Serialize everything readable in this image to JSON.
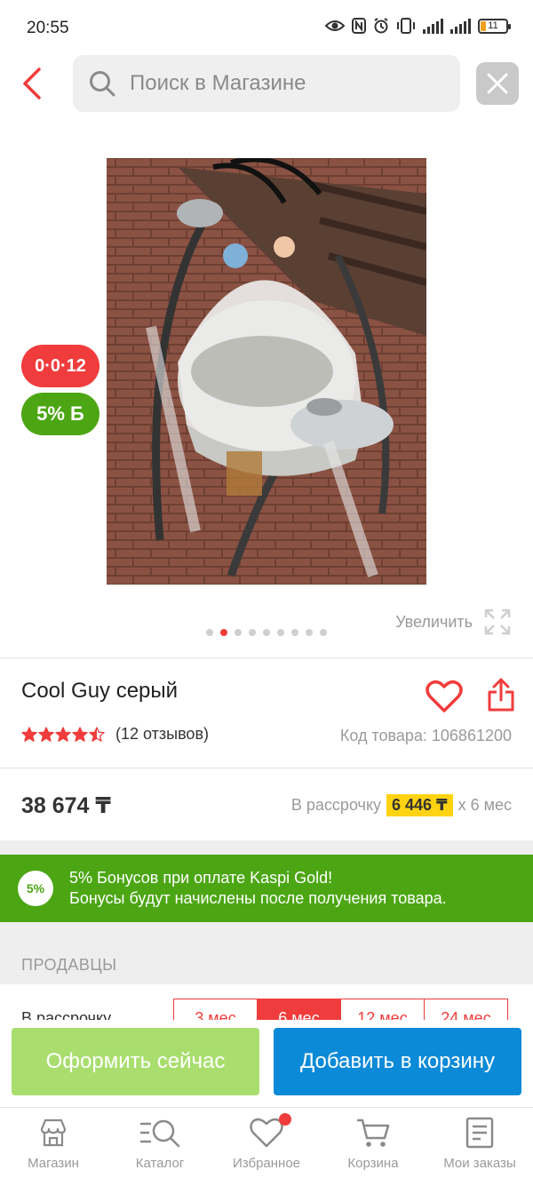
{
  "status_bar": {
    "time": "20:55",
    "battery_level": "11"
  },
  "search": {
    "placeholder": "Поиск в Магазине"
  },
  "product": {
    "image_alt": "photo",
    "badge_installment": "0·0·12",
    "badge_bonus": "5% Б",
    "zoom_label": "Увеличить",
    "gallery_dots": 9,
    "gallery_active_index": 1,
    "title": "Cool Guy серый",
    "rating": 4.5,
    "reviews": "(12 отзывов)",
    "code": "Код товара: 106861200",
    "price": "38 674 ₸",
    "installment_prefix": "В рассрочку",
    "installment_amount": "6 446 ₸",
    "installment_suffix": "х 6 мес"
  },
  "bonus": {
    "badge": "5%",
    "line1": "5% Бонусов при оплате Kaspi Gold!",
    "line2": "Бонусы будут начислены после получения товара."
  },
  "sellers": {
    "heading": "ПРОДАВЦЫ",
    "installment_label": "В рассрочку",
    "options": [
      "3 мес",
      "6 мес",
      "12 мес",
      "24 мес"
    ],
    "selected": "6 мес"
  },
  "actions": {
    "buy_now": "Оформить сейчас",
    "add_to_cart": "Добавить в корзину"
  },
  "nav": {
    "items": [
      {
        "label": "Магазин",
        "icon": "store-icon"
      },
      {
        "label": "Каталог",
        "icon": "catalog-search-icon"
      },
      {
        "label": "Избранное",
        "icon": "heart-icon"
      },
      {
        "label": "Корзина",
        "icon": "cart-icon"
      },
      {
        "label": "Мои заказы",
        "icon": "orders-icon"
      }
    ]
  },
  "colors": {
    "accent_red": "#f03c3c",
    "bonus_green": "#4ca614",
    "cart_blue": "#0b8ad8",
    "buy_green": "#a9de6f",
    "installment_yellow": "#ffd311"
  }
}
